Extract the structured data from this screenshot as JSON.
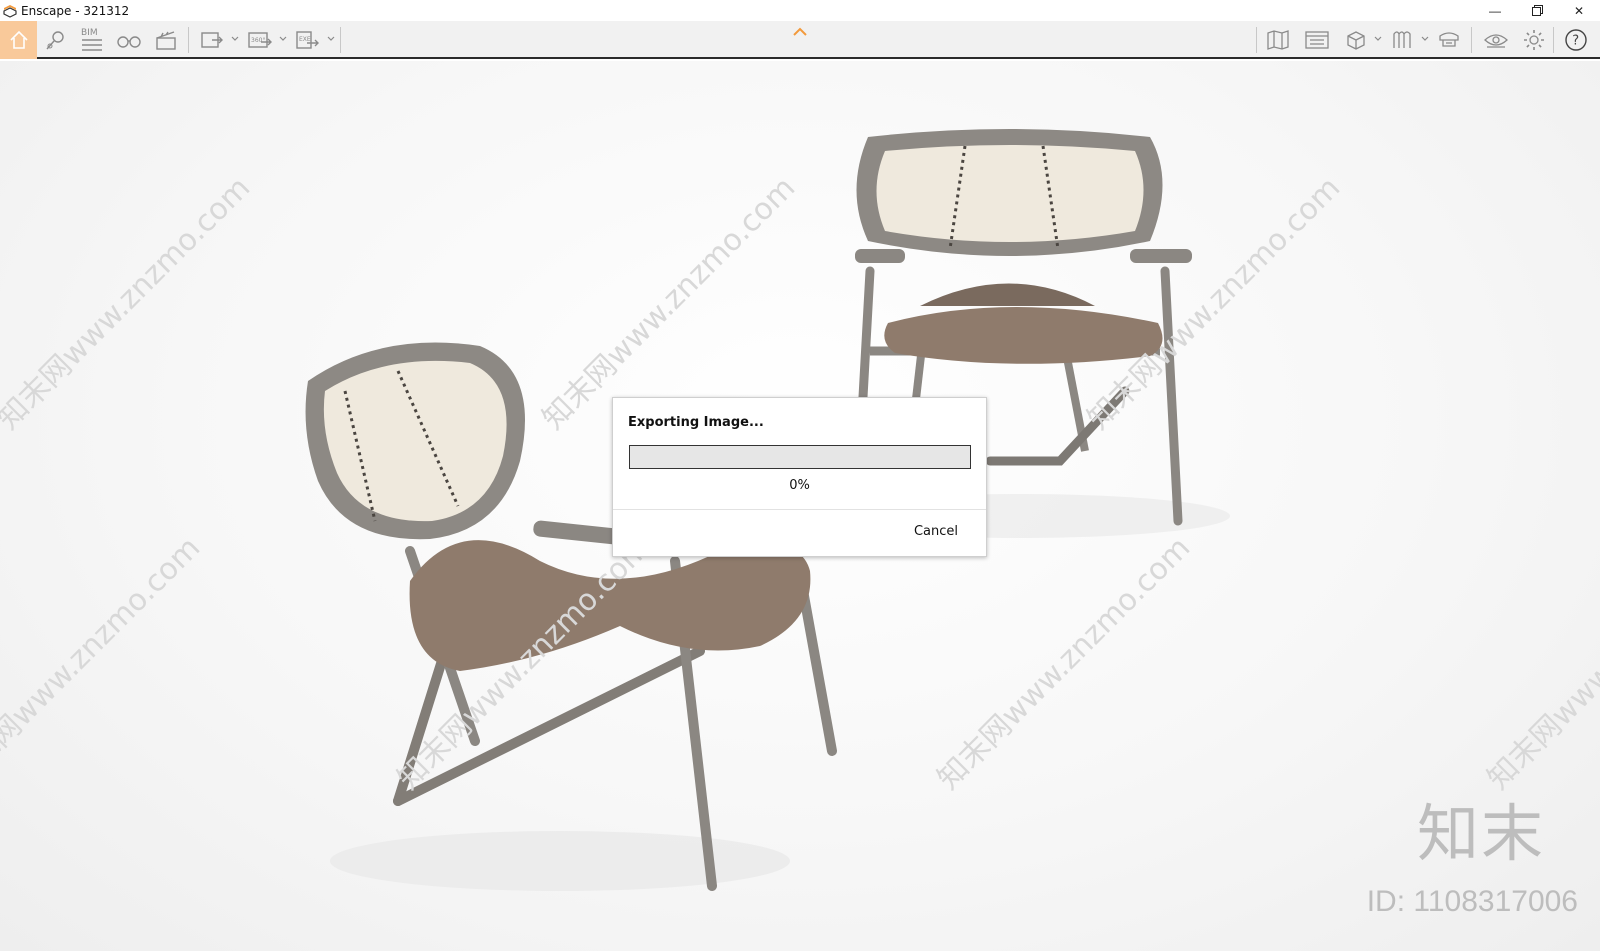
{
  "window": {
    "title": "Enscape - 321312",
    "minimize_icon": "minimize-icon",
    "restore_icon": "restore-icon",
    "close_icon": "close-icon"
  },
  "toolbar": {
    "left_items": [
      {
        "name": "home",
        "icon": "home-icon",
        "active": true
      },
      {
        "name": "views",
        "icon": "location-pin-icon"
      },
      {
        "name": "bim",
        "icon": "bim-icon",
        "label": "BIM"
      },
      {
        "name": "binoculars",
        "icon": "binoculars-icon"
      },
      {
        "name": "video-editor",
        "icon": "clapperboard-icon"
      },
      {
        "name": "render-image",
        "icon": "image-export-icon"
      },
      {
        "name": "panorama",
        "icon": "panorama-360-icon",
        "label": "360°"
      },
      {
        "name": "export-exe",
        "icon": "exe-export-icon",
        "label": "EXE"
      }
    ],
    "right_items": [
      {
        "name": "map",
        "icon": "map-icon"
      },
      {
        "name": "window",
        "icon": "window-icon"
      },
      {
        "name": "asset-library",
        "icon": "cube-icon"
      },
      {
        "name": "material",
        "icon": "material-icon"
      },
      {
        "name": "collaboration",
        "icon": "collaboration-icon"
      },
      {
        "name": "visual-settings-eye",
        "icon": "eye-icon"
      },
      {
        "name": "settings",
        "icon": "gear-icon"
      },
      {
        "name": "help",
        "icon": "help-icon"
      }
    ],
    "accent": "#f39a3c"
  },
  "dialog": {
    "title": "Exporting Image...",
    "progress": 0,
    "percent_label": "0%",
    "cancel_label": "Cancel"
  },
  "overlay": {
    "watermark_url": "知末网www.znzmo.com",
    "logo_cn": "知末",
    "id_label": "ID: 1108317006"
  }
}
